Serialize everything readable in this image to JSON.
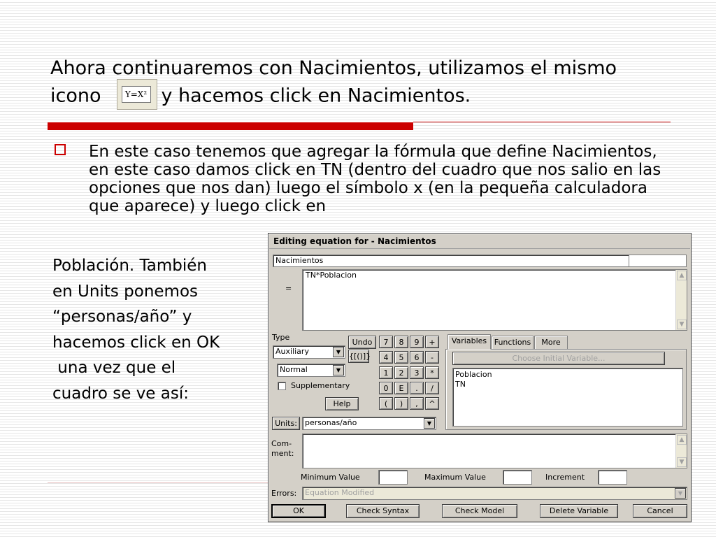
{
  "slide": {
    "title_part1": "Ahora continuaremos con Nacimientos, utilizamos el mismo icono",
    "title_icon_label": "Y=X²",
    "title_part2": "y hacemos click en Nacimientos.",
    "bullet_text": "En este caso tenemos que agregar la fórmula que define Nacimientos, en este caso damos click en TN (dentro del cuadro que nos salio en las opciones que nos dan) luego el símbolo x (en la pequeña calculadora que aparece) y luego click en",
    "side_lines": [
      "Población. También",
      "en Units ponemos",
      "“personas/año” y",
      "hacemos click en OK",
      " una vez que el",
      "cuadro se ve así:"
    ]
  },
  "dialog": {
    "title": "Editing equation for - Nacimientos",
    "variable_name": "Nacimientos",
    "equals_label": "=",
    "equation": "TN*Poblacion",
    "type_label": "Type",
    "type_value": "Auxiliary",
    "normal_value": "Normal",
    "supplementary_label": "Supplementary",
    "undo_label": "Undo",
    "brackets_label": "{[()]}",
    "help_label": "Help",
    "keypad": [
      [
        "7",
        "8",
        "9",
        "+"
      ],
      [
        "4",
        "5",
        "6",
        "-"
      ],
      [
        "1",
        "2",
        "3",
        "*"
      ],
      [
        "0",
        "E",
        ".",
        "/"
      ],
      [
        "(",
        ")",
        ",",
        "^"
      ]
    ],
    "tabs": [
      "Variables",
      "Functions",
      "More"
    ],
    "choose_initial_label": "Choose Initial Variable...",
    "variables": [
      "Poblacion",
      "TN"
    ],
    "units_button": "Units:",
    "units_value": "personas/año",
    "comment_label_1": "Com-",
    "comment_label_2": "ment:",
    "min_label": "Minimum Value",
    "max_label": "Maximum Value",
    "increment_label": "Increment",
    "errors_label": "Errors:",
    "errors_value": "Equation Modified",
    "buttons": {
      "ok": "OK",
      "check_syntax": "Check Syntax",
      "check_model": "Check Model",
      "delete_variable": "Delete Variable",
      "cancel": "Cancel"
    }
  }
}
